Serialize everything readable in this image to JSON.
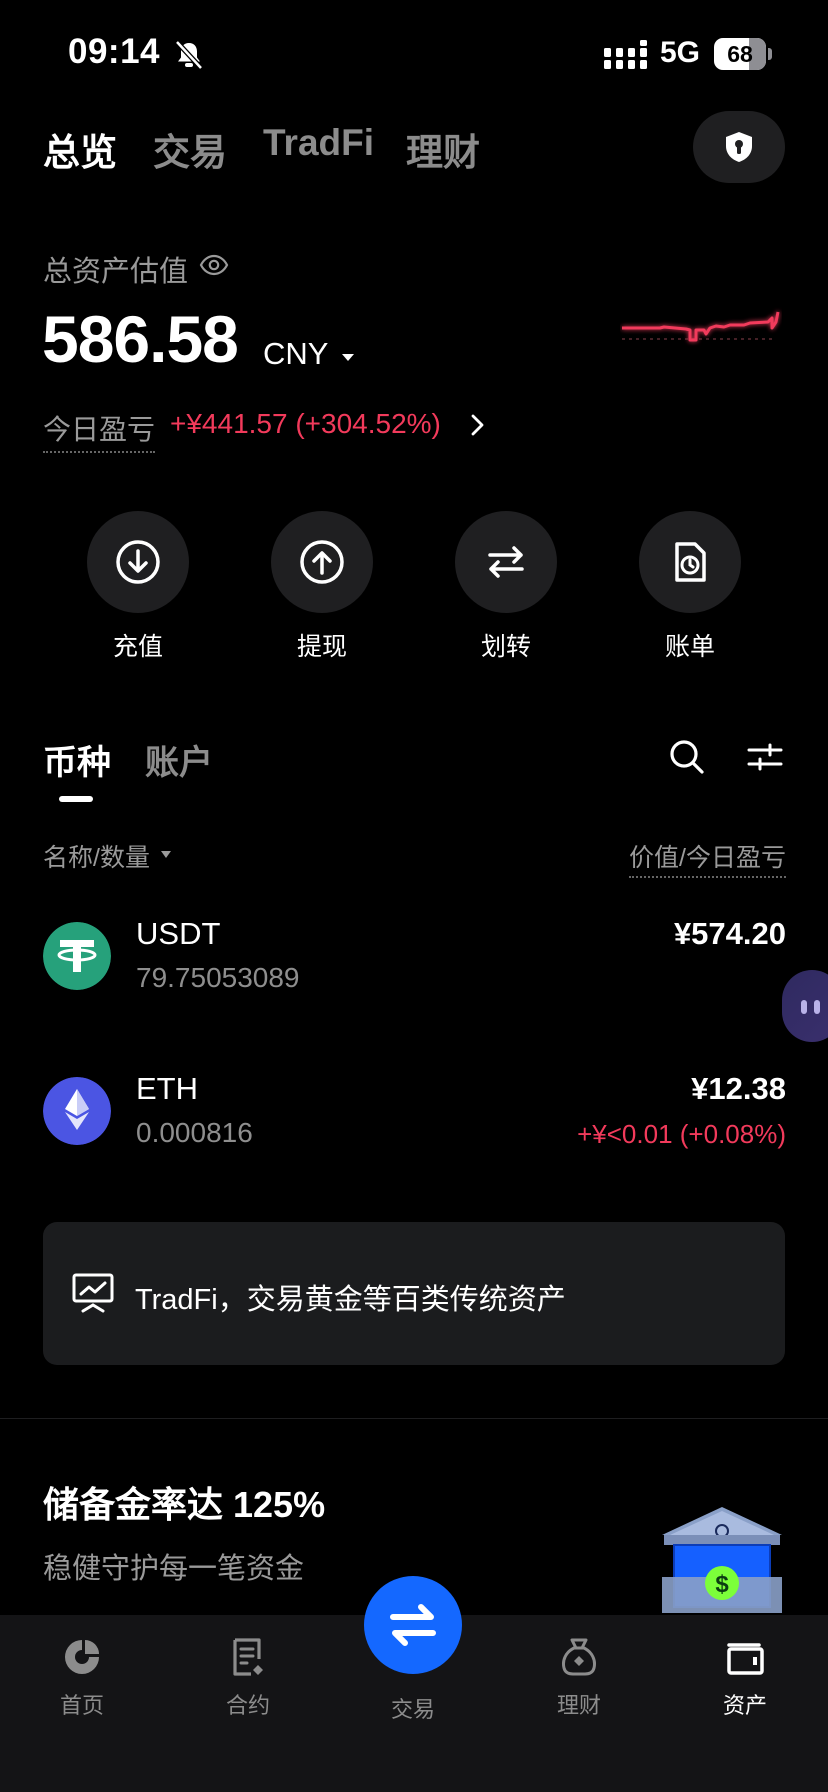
{
  "status_bar": {
    "time": "09:14",
    "network": "5G",
    "battery": "68",
    "battery_level_percent": 68,
    "icons": [
      "bell-muted-icon",
      "signal-icon",
      "battery-icon"
    ]
  },
  "top_tabs": [
    "总览",
    "交易",
    "TradFi",
    "理财"
  ],
  "top_tabs_active": "总览",
  "security_icon": "shield-lock-icon",
  "balance": {
    "label": "总资产估值",
    "amount": "586.58",
    "currency": "CNY",
    "pnl_label": "今日盈亏",
    "pnl_value": "+¥441.57 (+304.52%)"
  },
  "actions": [
    {
      "label": "充值",
      "icon": "download-icon"
    },
    {
      "label": "提现",
      "icon": "upload-icon"
    },
    {
      "label": "划转",
      "icon": "transfer-icon"
    },
    {
      "label": "账单",
      "icon": "bill-icon"
    }
  ],
  "asset_tabs": [
    "币种",
    "账户"
  ],
  "asset_tabs_active": "币种",
  "columns": {
    "left": "名称/数量",
    "right": "价值/今日盈亏"
  },
  "assets": [
    {
      "symbol": "USDT",
      "quantity": "79.75053089",
      "value": "¥574.20",
      "change": "",
      "icon": "tether-icon",
      "color": "#26a17b"
    },
    {
      "symbol": "ETH",
      "quantity": "0.000816",
      "value": "¥12.38",
      "change": "+¥<0.01 (+0.08%)",
      "icon": "ethereum-icon",
      "color": "#4b55e3"
    }
  ],
  "banner": {
    "text": "TradFi，交易黄金等百类传统资产",
    "icon": "chart-board-icon"
  },
  "reserve": {
    "title": "储备金率达 125%",
    "subtitle": "稳健守护每一笔资金",
    "icon": "vault-icon"
  },
  "bottom_nav": [
    {
      "label": "首页",
      "icon": "home-icon"
    },
    {
      "label": "合约",
      "icon": "contract-icon"
    },
    {
      "label": "交易",
      "icon": "swap-icon"
    },
    {
      "label": "理财",
      "icon": "earn-icon"
    },
    {
      "label": "资产",
      "icon": "wallet-icon"
    }
  ],
  "bottom_nav_active": "资产",
  "colors": {
    "background": "#000000",
    "surface": "#1f1f21",
    "loss_red": "#f23a5b",
    "accent_blue": "#1468ff"
  }
}
